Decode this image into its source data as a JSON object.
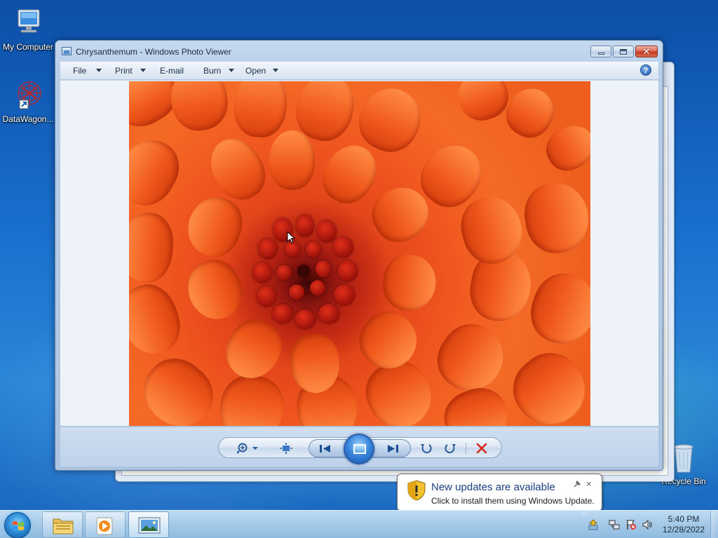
{
  "desktop": {
    "icons": [
      {
        "label": "My Computer",
        "icon": "computer-icon"
      },
      {
        "label": "DataWagon...",
        "icon": "datawagon-shortcut-icon"
      },
      {
        "label": "Recycle Bin",
        "icon": "recycle-bin-icon"
      }
    ]
  },
  "window": {
    "title": "Chrysanthemum - Windows Photo Viewer",
    "menu": [
      {
        "label": "File",
        "has_arrow": true
      },
      {
        "label": "Print",
        "has_arrow": true
      },
      {
        "label": "E-mail",
        "has_arrow": false
      },
      {
        "label": "Burn",
        "has_arrow": true
      },
      {
        "label": "Open",
        "has_arrow": true
      }
    ],
    "help": "?",
    "controls": {
      "zoom": "zoom-icon",
      "actual_size": "actual-size-icon",
      "previous": "previous-icon",
      "slideshow": "slideshow-icon",
      "next": "next-icon",
      "rotate_ccw": "rotate-counterclockwise-icon",
      "rotate_cw": "rotate-clockwise-icon",
      "delete": "delete-icon"
    }
  },
  "notification": {
    "title": "New updates are available",
    "text": "Click to install them using Windows Update.",
    "close": "×"
  },
  "taskbar": {
    "clock_time": "5:40 PM",
    "clock_date": "12/28/2022",
    "pinned": [
      {
        "name": "explorer",
        "icon": "folder-icon"
      },
      {
        "name": "media-player",
        "icon": "media-player-icon"
      },
      {
        "name": "photo-viewer",
        "icon": "photo-viewer-icon",
        "active": true
      }
    ]
  },
  "colors": {
    "accent": "#2a5b9a",
    "delete_red": "#d42a1e",
    "flower_orange": "#f05a1c"
  }
}
